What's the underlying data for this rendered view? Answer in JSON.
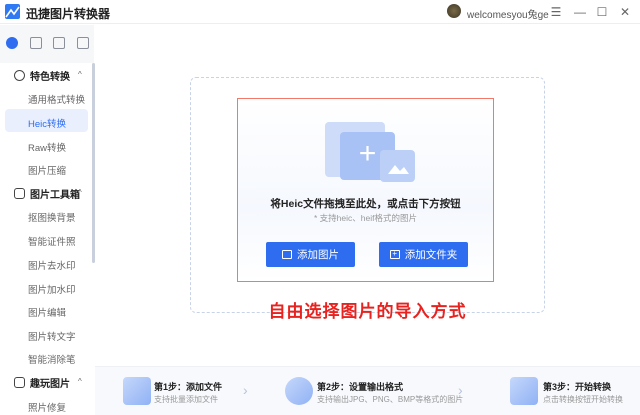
{
  "app": {
    "title": "迅捷图片转换器",
    "user": "welcomesyou兔ge"
  },
  "window": {
    "menu": "☰",
    "minimize": "—",
    "maximize": "☐",
    "close": "✕"
  },
  "sidebar": {
    "groups": [
      {
        "label": "特色转换",
        "items": [
          "通用格式转换",
          "Heic转换",
          "Raw转换",
          "图片压缩"
        ]
      },
      {
        "label": "图片工具箱",
        "items": [
          "抠图换背景",
          "智能证件照",
          "图片去水印",
          "图片加水印",
          "图片编辑",
          "图片转文字",
          "智能消除笔"
        ]
      },
      {
        "label": "趣玩图片",
        "items": [
          "照片修复"
        ]
      }
    ],
    "active": "Heic转换"
  },
  "drop": {
    "title": "将Heic文件拖拽至此处，或点击下方按钮",
    "subtitle": "* 支持heic、heif格式的图片",
    "add_image": "添加图片",
    "add_folder": "添加文件夹",
    "plus": "+"
  },
  "annotation": "自由选择图片的导入方式",
  "steps": [
    {
      "title": "第1步：添加文件",
      "desc": "支持批量添加文件"
    },
    {
      "title": "第2步：设置输出格式",
      "desc": "支持输出JPG、PNG、BMP等格式的图片"
    },
    {
      "title": "第3步：开始转换",
      "desc": "点击转换按钮开始转换"
    }
  ],
  "colors": {
    "accent": "#2f6df0",
    "annotation": "#e8231f",
    "highlight_box": "#f2796a"
  }
}
